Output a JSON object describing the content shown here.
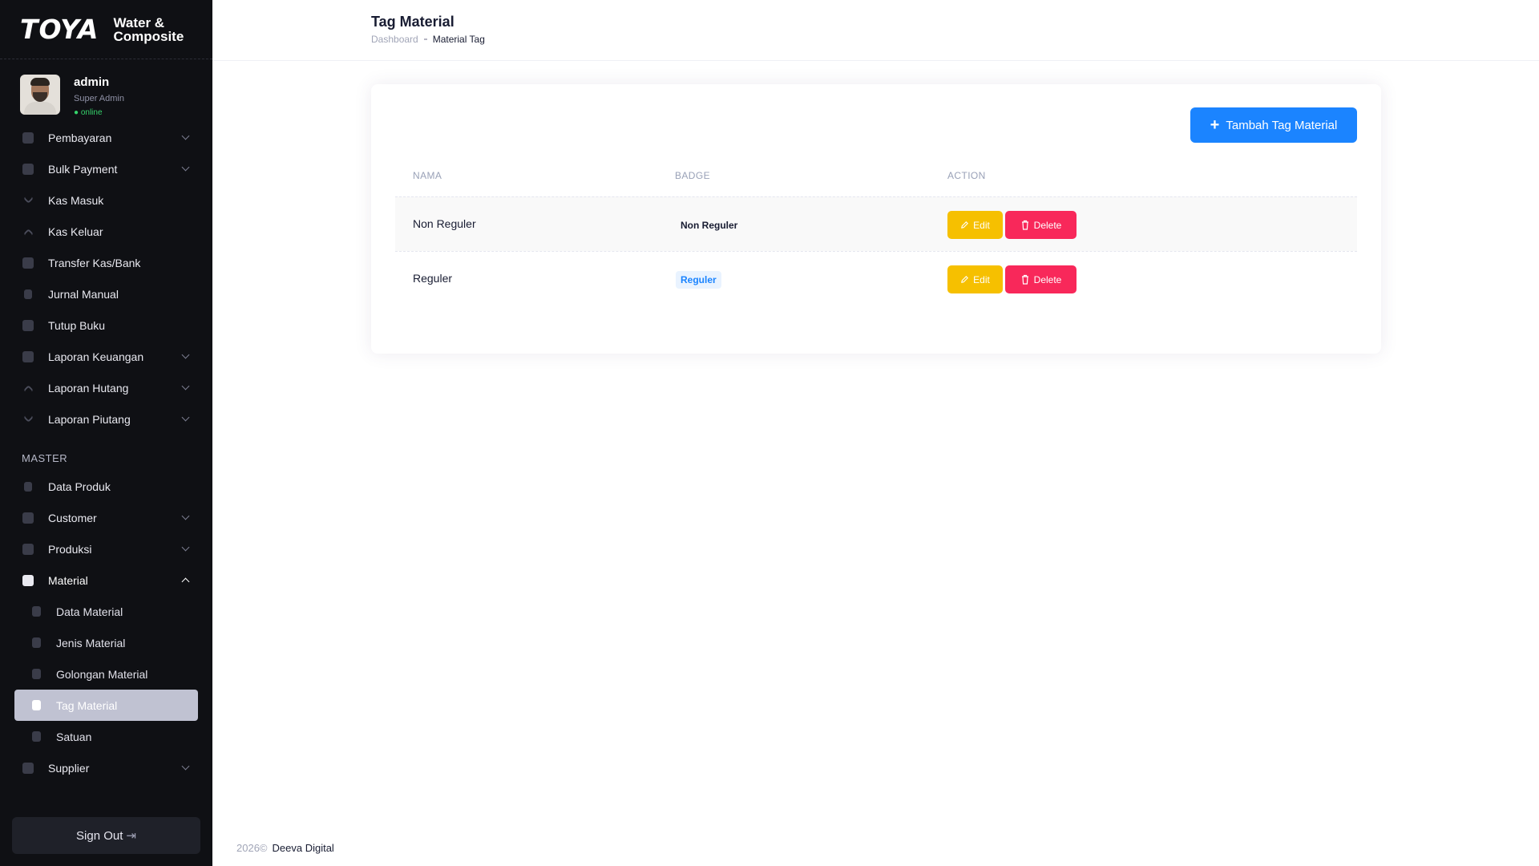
{
  "brand": {
    "logo": "TOYA",
    "name_line1": "Water &",
    "name_line2": "Composite"
  },
  "user": {
    "name": "admin",
    "role": "Super Admin",
    "status": "● online"
  },
  "sidebar": {
    "items": [
      {
        "label": "Pembayaran",
        "icon": "payment-icon",
        "has_submenu": true
      },
      {
        "label": "Bulk Payment",
        "icon": "wallet-icon",
        "has_submenu": true
      },
      {
        "label": "Kas Masuk",
        "icon": "arrow-down-icon",
        "has_submenu": false
      },
      {
        "label": "Kas Keluar",
        "icon": "arrow-up-icon",
        "has_submenu": false
      },
      {
        "label": "Transfer Kas/Bank",
        "icon": "toggle-icon",
        "has_submenu": false
      },
      {
        "label": "Jurnal Manual",
        "icon": "journal-icon",
        "has_submenu": false
      },
      {
        "label": "Tutup Buku",
        "icon": "calendar-icon",
        "has_submenu": false
      },
      {
        "label": "Laporan Keuangan",
        "icon": "chart-icon",
        "has_submenu": true
      },
      {
        "label": "Laporan Hutang",
        "icon": "arrow-up-icon",
        "has_submenu": true
      },
      {
        "label": "Laporan Piutang",
        "icon": "arrow-down-icon",
        "has_submenu": true
      }
    ],
    "master_title": "MASTER",
    "master_items": [
      {
        "label": "Data Produk",
        "icon": "document-icon",
        "has_submenu": false
      },
      {
        "label": "Customer",
        "icon": "package-icon",
        "has_submenu": true
      },
      {
        "label": "Produksi",
        "icon": "package-icon",
        "has_submenu": true
      },
      {
        "label": "Material",
        "icon": "package-icon",
        "has_submenu": true,
        "expanded": true
      }
    ],
    "material_submenu": [
      {
        "label": "Data Material"
      },
      {
        "label": "Jenis Material"
      },
      {
        "label": "Golongan Material"
      },
      {
        "label": "Tag Material",
        "active": true
      },
      {
        "label": "Satuan"
      }
    ],
    "supplier": {
      "label": "Supplier",
      "icon": "package-icon",
      "has_submenu": true
    },
    "signout_label": "Sign Out"
  },
  "header": {
    "title": "Tag Material",
    "breadcrumb": {
      "home": "Dashboard",
      "current": "Material Tag"
    }
  },
  "main": {
    "add_button_label": "Tambah Tag Material",
    "columns": {
      "name": "NAMA",
      "badge": "BADGE",
      "action": "ACTION"
    },
    "rows": [
      {
        "name": "Non Reguler",
        "badge": "Non Reguler",
        "badge_style": "plain"
      },
      {
        "name": "Reguler",
        "badge": "Reguler",
        "badge_style": "light-primary"
      }
    ],
    "edit_label": "Edit",
    "delete_label": "Delete"
  },
  "footer": {
    "year": "2026©",
    "company": "Deeva Digital"
  },
  "colors": {
    "sidebar_bg": "#0f1014",
    "primary": "#1b84ff",
    "warning": "#f6c000",
    "danger": "#f8285a",
    "active_item": "#c0c2d2"
  }
}
